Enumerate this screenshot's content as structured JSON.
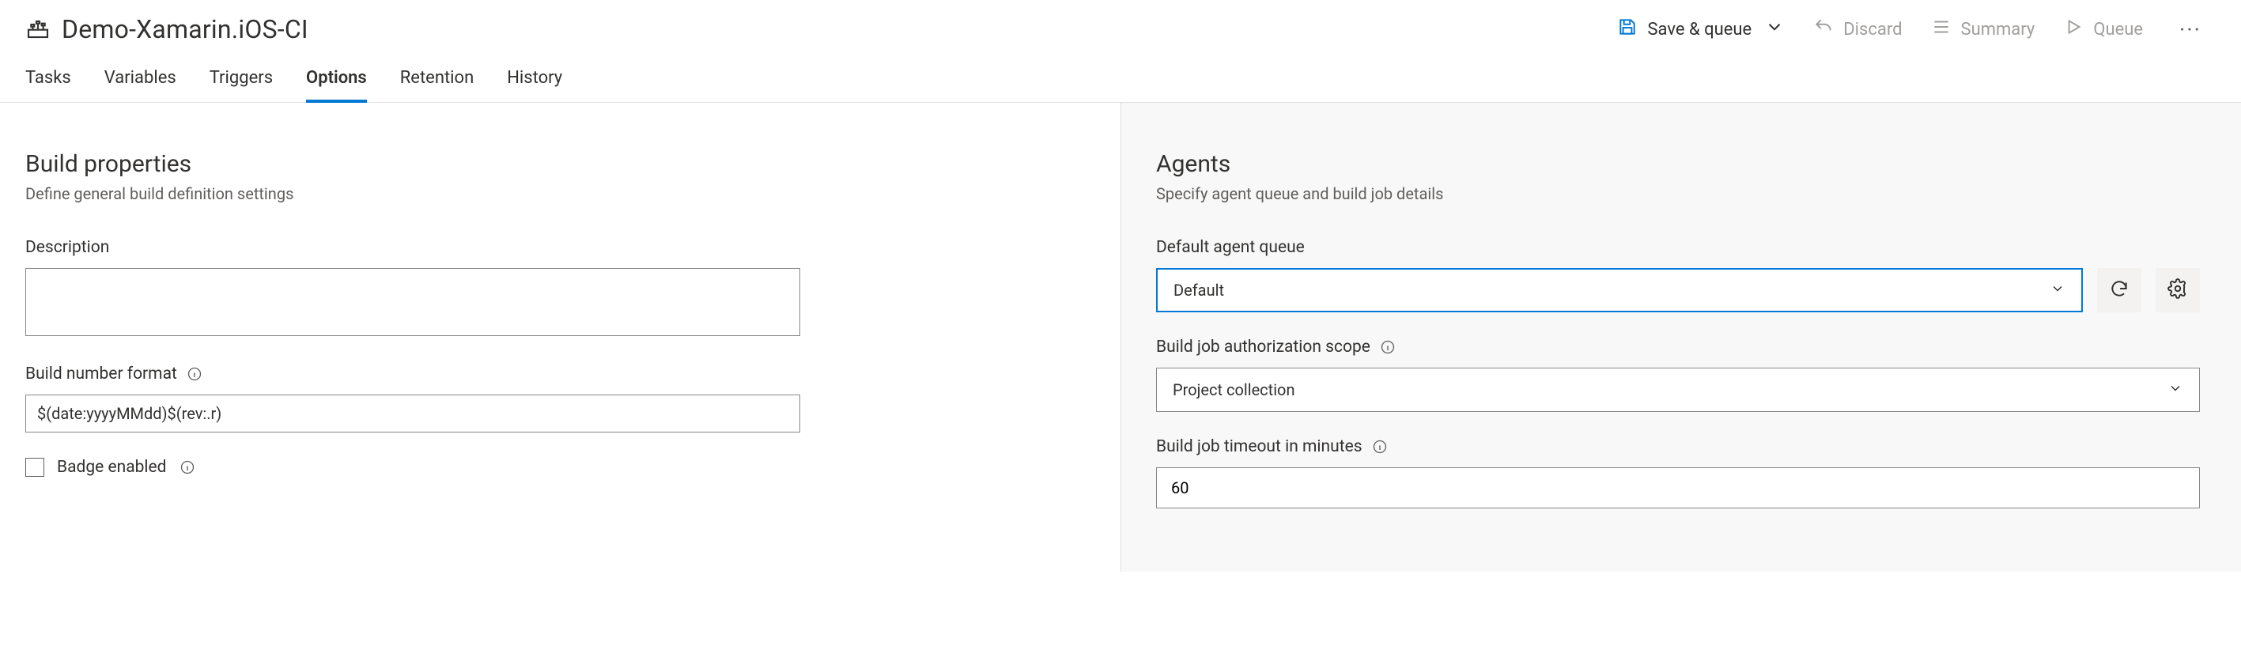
{
  "header": {
    "title": "Demo-Xamarin.iOS-CI",
    "actions": {
      "save_queue": "Save & queue",
      "discard": "Discard",
      "summary": "Summary",
      "queue": "Queue"
    }
  },
  "tabs": [
    "Tasks",
    "Variables",
    "Triggers",
    "Options",
    "Retention",
    "History"
  ],
  "active_tab": "Options",
  "left": {
    "title": "Build properties",
    "subtitle": "Define general build definition settings",
    "description_label": "Description",
    "description_value": "",
    "build_number_label": "Build number format",
    "build_number_value": "$(date:yyyyMMdd)$(rev:.r)",
    "badge_label": "Badge enabled"
  },
  "right": {
    "title": "Agents",
    "subtitle": "Specify agent queue and build job details",
    "queue_label": "Default agent queue",
    "queue_value": "Default",
    "scope_label": "Build job authorization scope",
    "scope_value": "Project collection",
    "timeout_label": "Build job timeout in minutes",
    "timeout_value": "60"
  },
  "colors": {
    "accent": "#0078d4"
  }
}
